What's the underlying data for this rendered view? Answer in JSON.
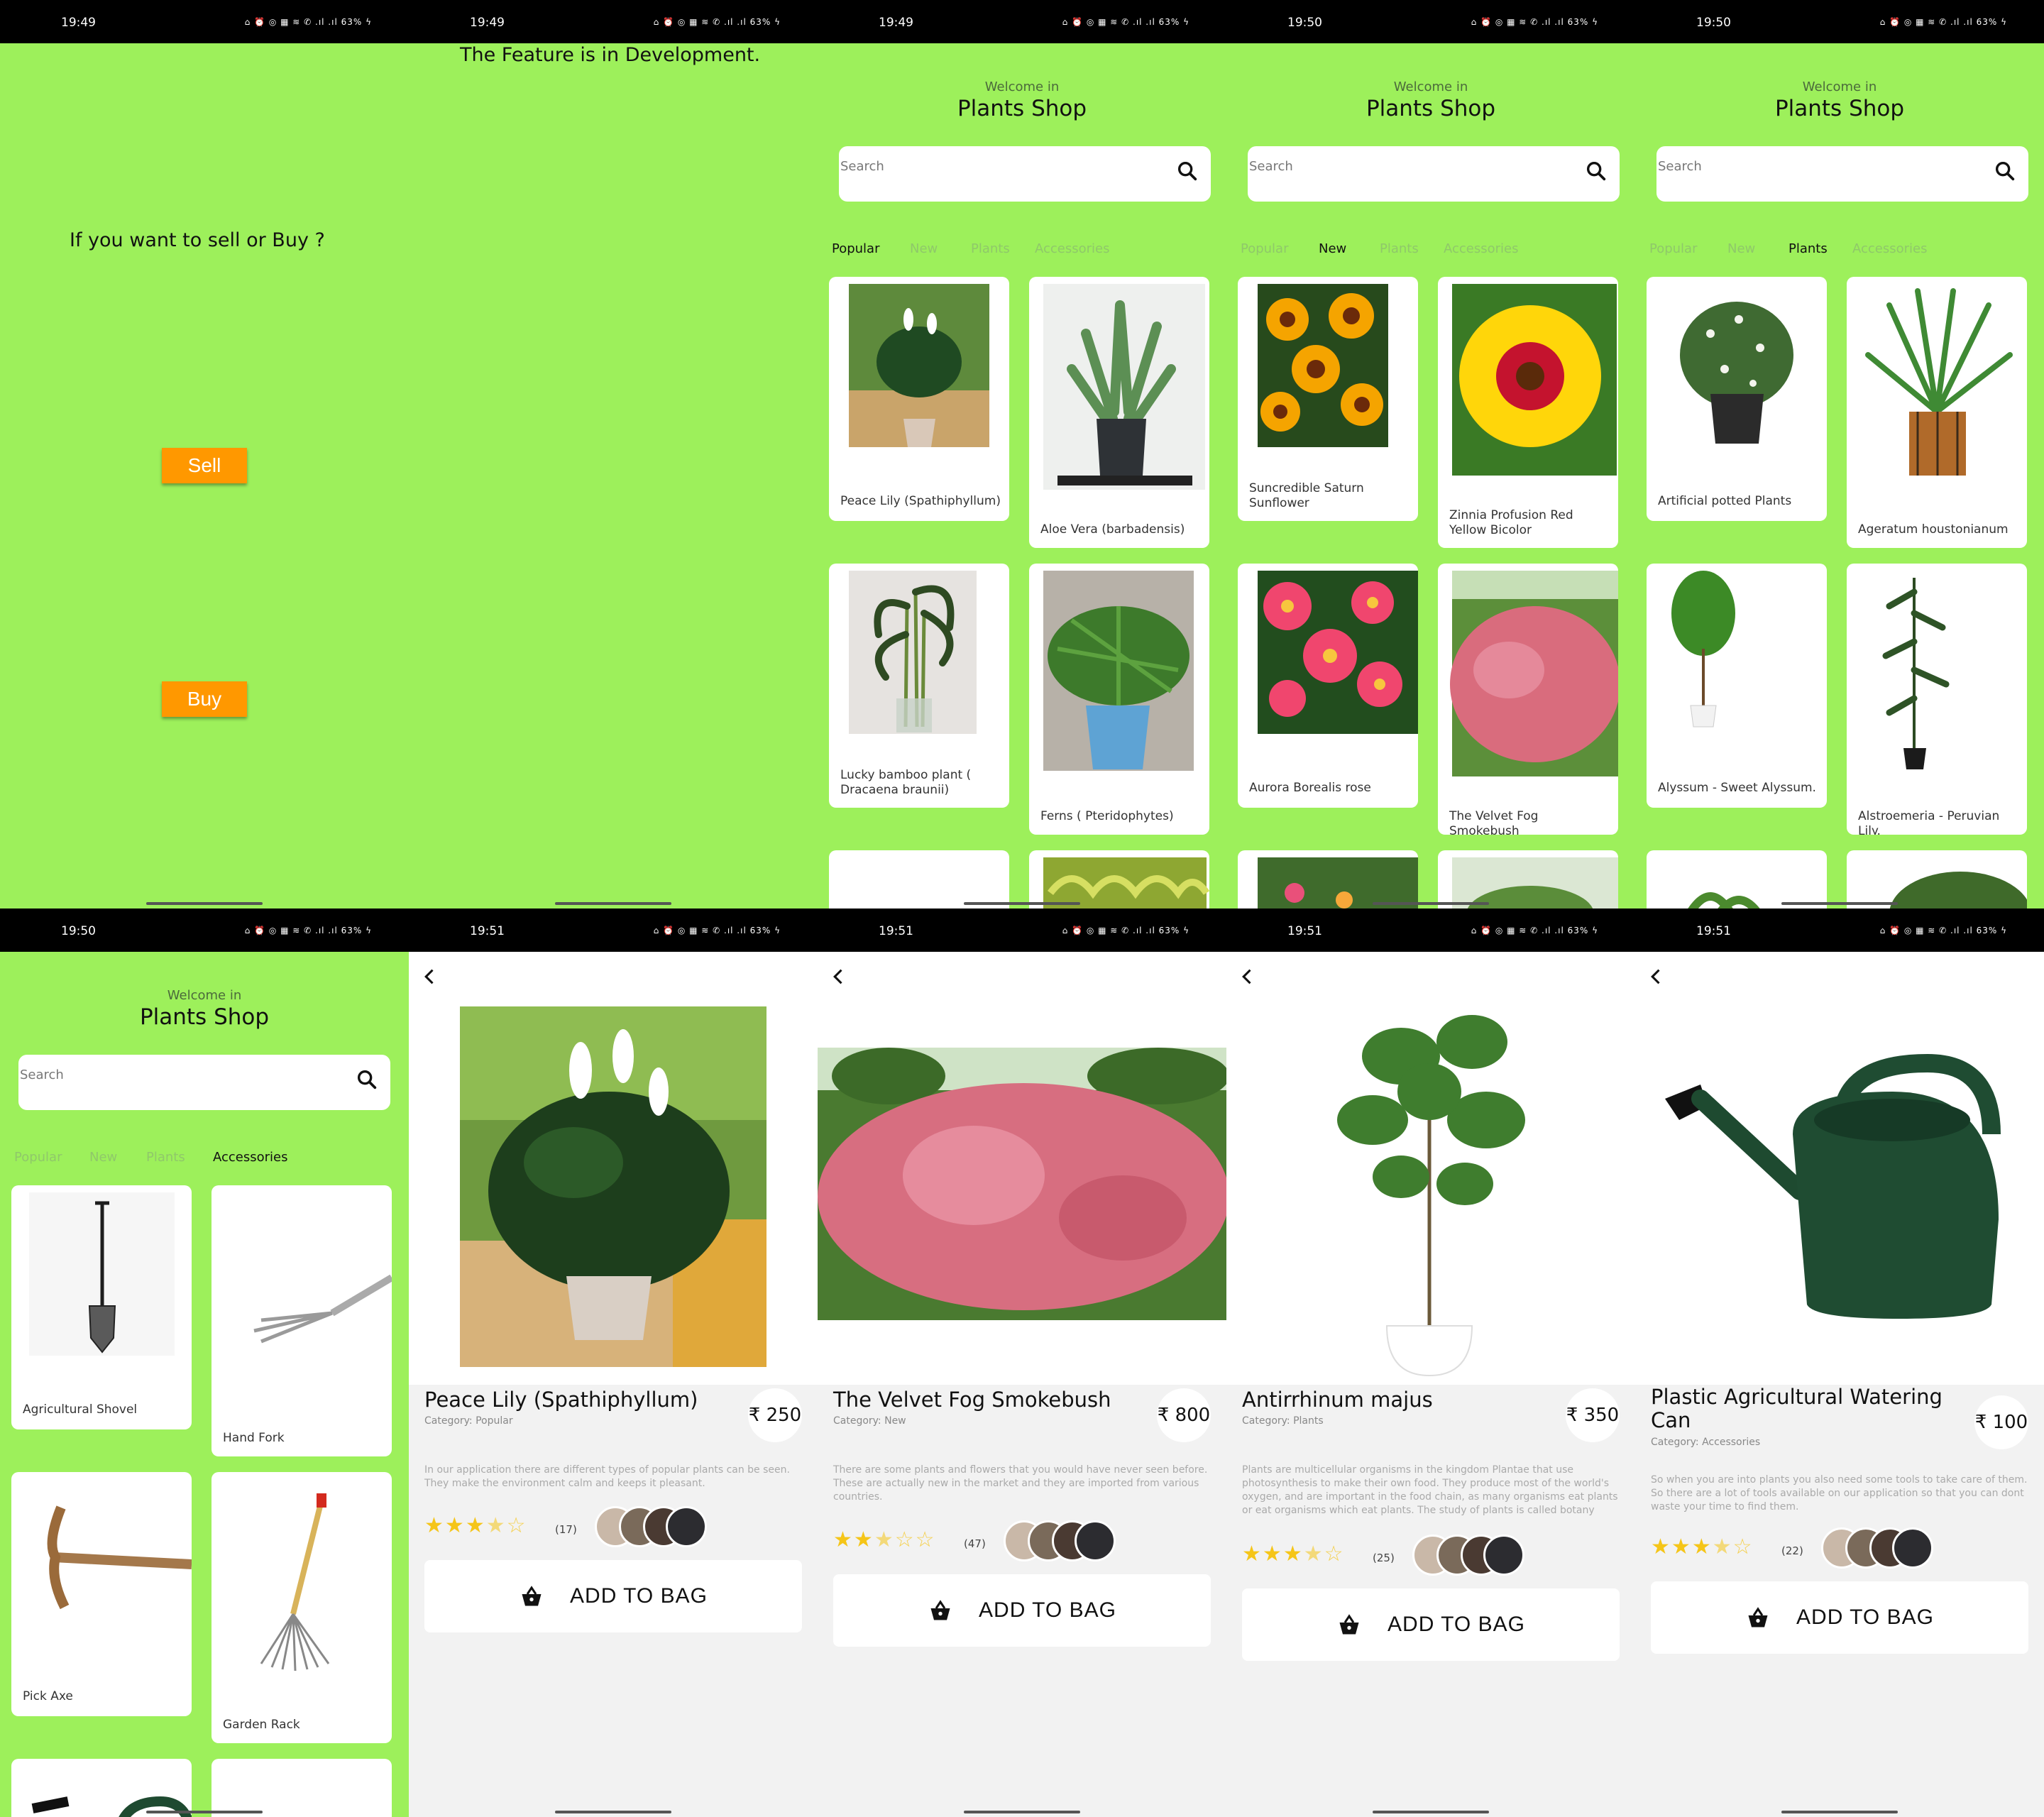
{
  "status": {
    "top": [
      "19:49",
      "19:49",
      "19:49",
      "19:50",
      "19:50"
    ],
    "bottom": [
      "19:50",
      "19:51",
      "19:51",
      "19:51",
      "19:51"
    ],
    "icons": "⌂ ⏰ ◎ ▦ ≋ ✆ .ıl .ıl 63% ϟ"
  },
  "choose": {
    "question": "If you want to sell or Buy ?",
    "sell_label": "Sell",
    "buy_label": "Buy"
  },
  "dev": {
    "message": "The Feature is in Development."
  },
  "shop": {
    "welcome": "Welcome in",
    "name": "Plants Shop",
    "search_placeholder": "Search",
    "tabs": [
      "Popular",
      "New",
      "Plants",
      "Accessories"
    ]
  },
  "lists": {
    "popular": [
      "Peace Lily (Spathiphyllum)",
      "Aloe Vera (barbadensis)",
      "Lucky bamboo plant ( Dracaena braunii)",
      "Ferns ( Pteridophytes)"
    ],
    "new": [
      "Suncredible Saturn Sunflower",
      "Zinnia Profusion Red Yellow Bicolor",
      "Aurora Borealis rose",
      "The Velvet Fog Smokebush"
    ],
    "plants": [
      "Artificial potted Plants",
      "Ageratum houstonianum",
      "Alyssum - Sweet Alyssum.",
      "Alstroemeria - Peruvian Lily."
    ],
    "accessories": [
      "Agricultural Shovel",
      "Hand Fork",
      "Pick Axe",
      "Garden Rack"
    ]
  },
  "details": [
    {
      "title": "Peace Lily (Spathiphyllum)",
      "category": "Category: Popular",
      "price": "₹ 250",
      "desc": "In our application there are different types of popular plants can be seen. They make the environment calm and keeps it pleasant.",
      "rating": 3.5,
      "count": "(17)",
      "bag": "ADD TO BAG"
    },
    {
      "title": "The Velvet Fog Smokebush",
      "category": "Category: New",
      "price": "₹ 800",
      "desc": "There are some plants and flowers that you would have never seen before. These are actually new in the market and they are imported from various countries.",
      "rating": 2.5,
      "count": "(47)",
      "bag": "ADD TO BAG"
    },
    {
      "title": "Antirrhinum majus",
      "category": "Category: Plants",
      "price": "₹ 350",
      "desc": "Plants are multicellular organisms in the kingdom Plantae that use photosynthesis to make their own food. They produce most of the world's oxygen, and are important in the food chain, as many organisms eat plants or eat organisms which eat plants. The study of plants is called botany",
      "rating": 3.5,
      "count": "(25)",
      "bag": "ADD TO BAG"
    },
    {
      "title": "Plastic Agricultural Watering Can",
      "category": "Category: Accessories",
      "price": "₹ 100",
      "desc": "So when you are into plants you also need some tools to take care of them. So there are a lot of tools available on our application so that you can dont waste your time to find them.",
      "rating": 3.5,
      "count": "(22)",
      "bag": "ADD TO BAG"
    }
  ],
  "colors": {
    "bg_green": "#9df05b",
    "button_orange": "#ff9800",
    "star": "#f5c518",
    "tab_inactive": "#8fc86a"
  }
}
